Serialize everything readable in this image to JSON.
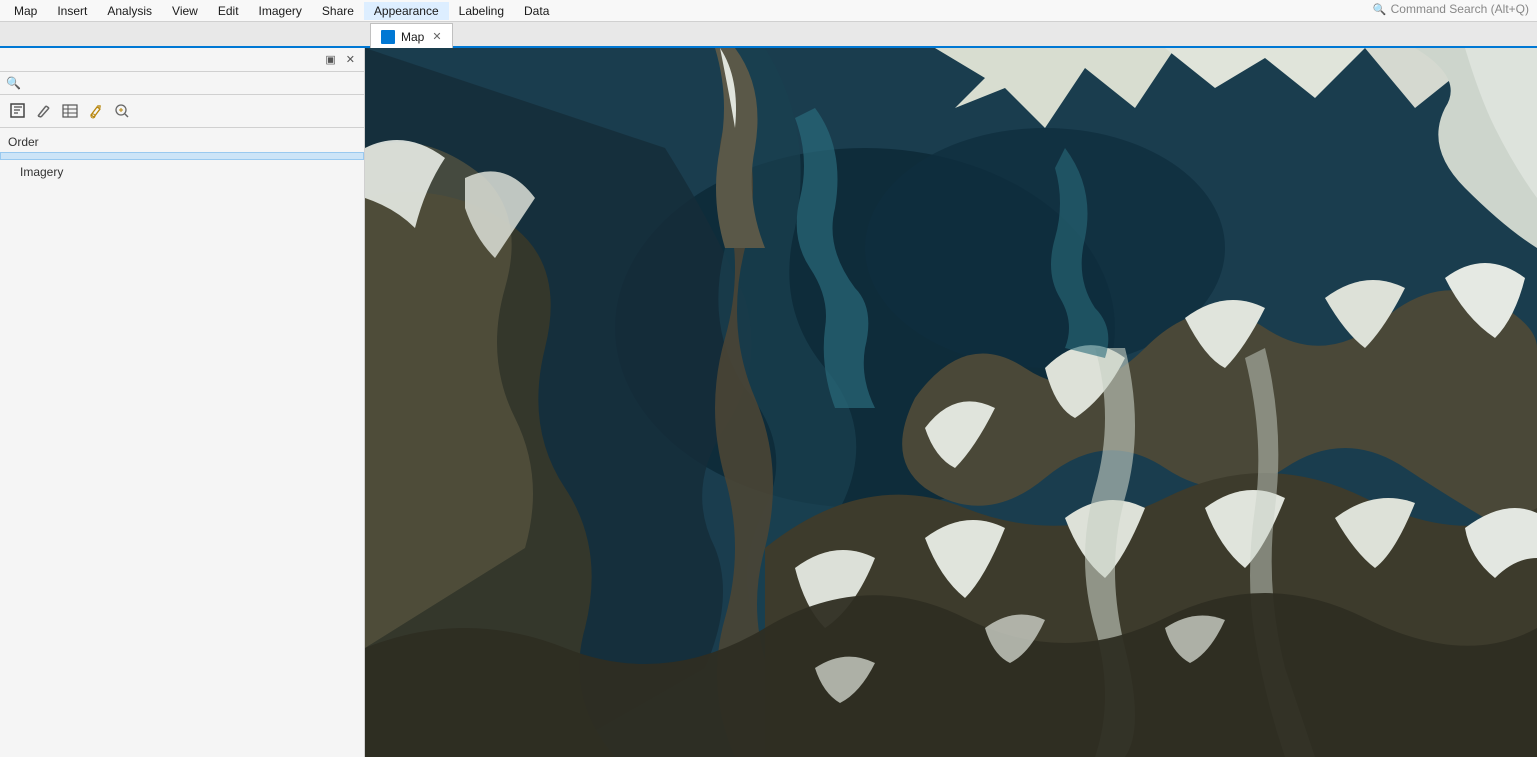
{
  "menubar": {
    "items": [
      {
        "label": "Map",
        "active": false
      },
      {
        "label": "Insert",
        "active": false
      },
      {
        "label": "Analysis",
        "active": false
      },
      {
        "label": "View",
        "active": false
      },
      {
        "label": "Edit",
        "active": false
      },
      {
        "label": "Imagery",
        "active": false
      },
      {
        "label": "Share",
        "active": false
      },
      {
        "label": "Appearance",
        "active": true
      },
      {
        "label": "Labeling",
        "active": false
      },
      {
        "label": "Data",
        "active": false
      }
    ],
    "command_search_placeholder": "Command Search (Alt+Q)"
  },
  "tabs": [
    {
      "label": "Map",
      "active": true,
      "closeable": true
    }
  ],
  "panel": {
    "header_pin": "▣",
    "header_close": "✕",
    "search_placeholder": "",
    "toolbar_icons": [
      "select",
      "draw",
      "table",
      "paint",
      "analyze"
    ],
    "section_order_label": "Order",
    "selected_layer": "",
    "layers": [
      {
        "label": "Imagery"
      }
    ]
  }
}
